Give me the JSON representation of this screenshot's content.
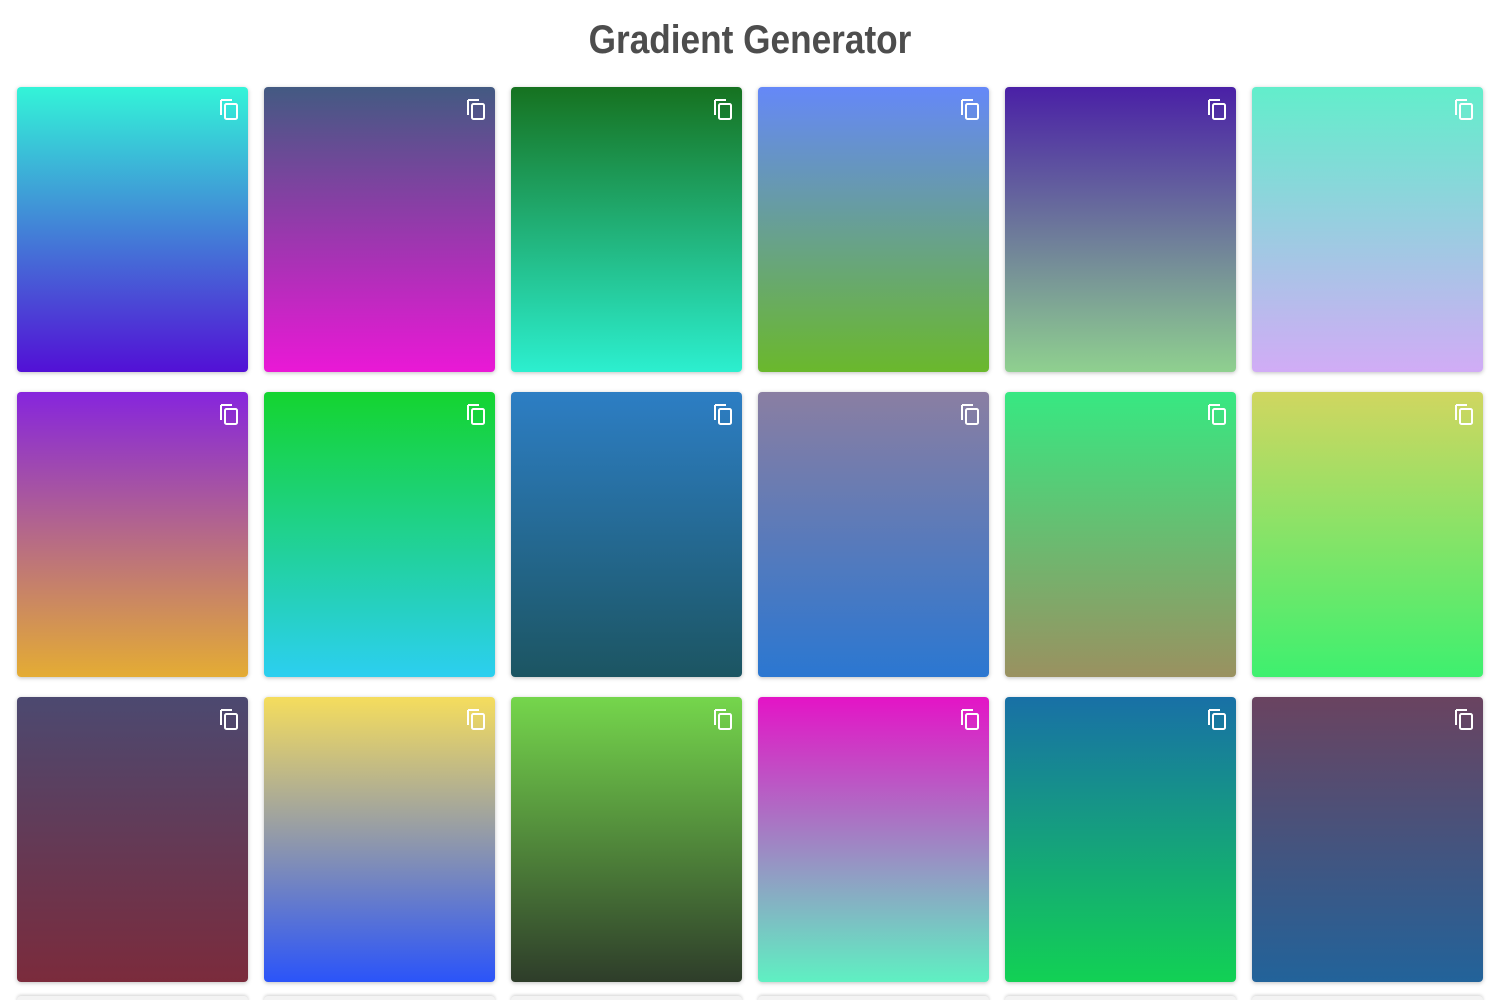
{
  "title": "Gradient Generator",
  "icon": "copy-icon",
  "gradients": [
    {
      "top": "#33f4d8",
      "bottom": "#5210d6"
    },
    {
      "top": "#435a82",
      "bottom": "#ea18d6"
    },
    {
      "top": "#167220",
      "bottom": "#2cefcf"
    },
    {
      "top": "#6588f8",
      "bottom": "#6ab82c"
    },
    {
      "top": "#4a20a6",
      "bottom": "#8fd08f"
    },
    {
      "top": "#62eecb",
      "bottom": "#d1acf6"
    },
    {
      "top": "#8625dd",
      "bottom": "#e4ac34"
    },
    {
      "top": "#14d42f",
      "bottom": "#2ccff0"
    },
    {
      "top": "#2d7ec4",
      "bottom": "#1c5562"
    },
    {
      "top": "#8a7ea2",
      "bottom": "#2b77d1"
    },
    {
      "top": "#37e882",
      "bottom": "#9a9160"
    },
    {
      "top": "#d0d660",
      "bottom": "#3ef06f"
    },
    {
      "top": "#4c4970",
      "bottom": "#7b2b3c"
    },
    {
      "top": "#f5dd5d",
      "bottom": "#2b54f9"
    },
    {
      "top": "#75d64c",
      "bottom": "#2e3d2a"
    },
    {
      "top": "#e414c6",
      "bottom": "#5ff0c2"
    },
    {
      "top": "#1870a6",
      "bottom": "#12d154"
    },
    {
      "top": "#6a4360",
      "bottom": "#22639a"
    }
  ]
}
